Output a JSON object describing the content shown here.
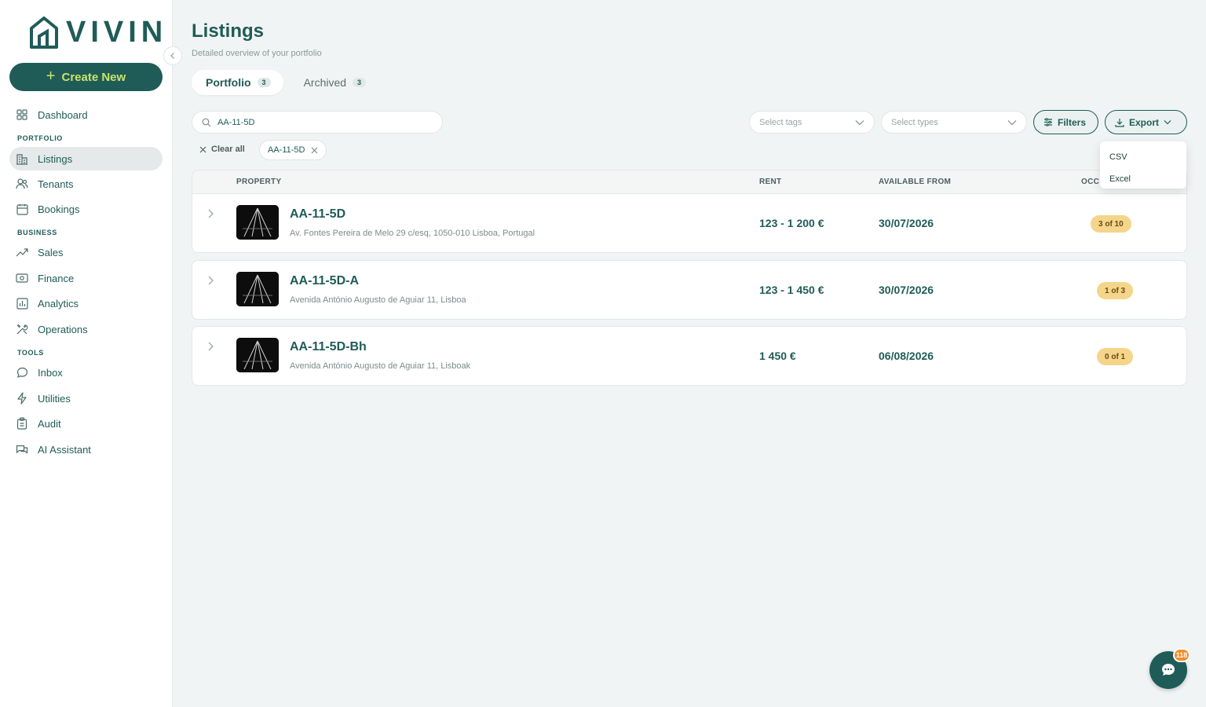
{
  "brand": {
    "name": "VIVIN"
  },
  "sidebar": {
    "create_label": "Create New",
    "sections": {
      "portfolio": "PORTFOLIO",
      "business": "BUSINESS",
      "tools": "TOOLS"
    },
    "items": [
      {
        "label": "Dashboard",
        "icon": "grid-icon"
      },
      {
        "label": "Listings",
        "icon": "building-icon",
        "active": true
      },
      {
        "label": "Tenants",
        "icon": "users-icon"
      },
      {
        "label": "Bookings",
        "icon": "calendar-icon"
      },
      {
        "label": "Sales",
        "icon": "trend-up-icon"
      },
      {
        "label": "Finance",
        "icon": "banknote-icon"
      },
      {
        "label": "Analytics",
        "icon": "bar-chart-icon"
      },
      {
        "label": "Operations",
        "icon": "tools-icon"
      },
      {
        "label": "Inbox",
        "icon": "message-icon"
      },
      {
        "label": "Utilities",
        "icon": "lightning-icon"
      },
      {
        "label": "Audit",
        "icon": "clipboard-icon"
      },
      {
        "label": "AI Assistant",
        "icon": "chat-bubbles-icon"
      }
    ]
  },
  "header": {
    "title": "Listings",
    "subtitle": "Detailed overview of your portfolio"
  },
  "tabs": [
    {
      "label": "Portfolio",
      "count": "3",
      "active": true
    },
    {
      "label": "Archived",
      "count": "3"
    }
  ],
  "toolbar": {
    "search_value": "AA-11-5D",
    "tags_placeholder": "Select tags",
    "types_placeholder": "Select types",
    "filters_label": "Filters",
    "export_label": "Export",
    "clear_all_label": "Clear all",
    "active_chip": "AA-11-5D"
  },
  "export_menu": {
    "options": [
      "CSV",
      "Excel"
    ]
  },
  "table": {
    "columns": {
      "property": "PROPERTY",
      "rent": "RENT",
      "available": "AVAILABLE FROM",
      "occupancy": "OCC"
    },
    "rows": [
      {
        "name": "AA-11-5D",
        "address": "Av. Fontes Pereira de Melo 29 c/esq, 1050-010 Lisboa, Portugal",
        "rent": "123 - 1 200 €",
        "available": "30/07/2026",
        "occupancy": "3 of 10"
      },
      {
        "name": "AA-11-5D-A",
        "address": "Avenida António Augusto de Aguiar 11, Lisboa",
        "rent": "123 - 1 450 €",
        "available": "30/07/2026",
        "occupancy": "1 of 3"
      },
      {
        "name": "AA-11-5D-Bh",
        "address": "Avenida António Augusto de Aguiar 11, Lisboak",
        "rent": "1 450 €",
        "available": "06/08/2026",
        "occupancy": "0 of 1"
      }
    ]
  },
  "chat": {
    "badge": "118"
  },
  "colors": {
    "primary": "#1f5c57",
    "accent": "#c9e46b",
    "badge": "#f4d58a",
    "notification": "#f28c28"
  }
}
